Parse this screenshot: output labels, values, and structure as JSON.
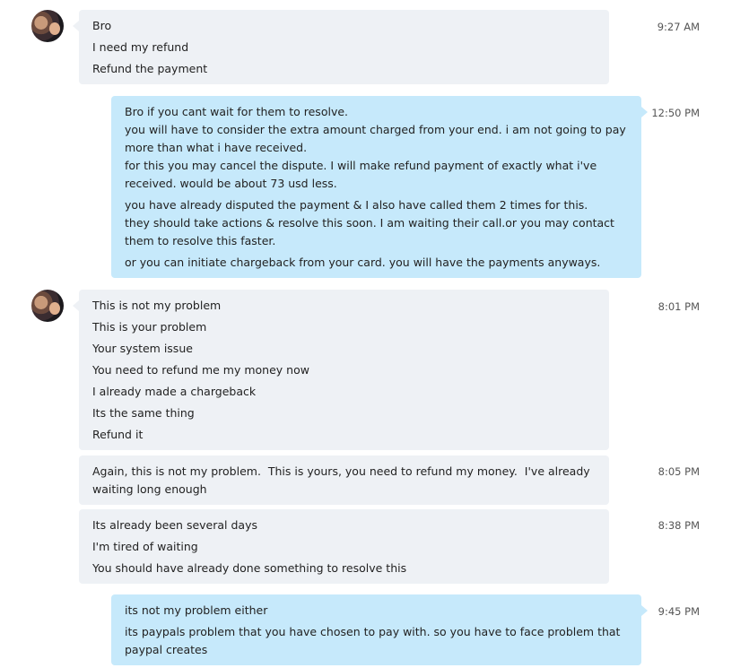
{
  "messages": [
    {
      "id": "m1",
      "time": "9:27 AM",
      "lines": [
        "Bro",
        "I need my refund",
        "Refund the payment"
      ]
    },
    {
      "id": "m2",
      "time": "12:50 PM",
      "lines": [
        "Bro if you cant wait for them to resolve.",
        "you will have to consider the extra amount charged from your end. i am not going to pay more than what i have received.",
        "for this you may cancel the dispute. I will make refund payment of exactly what i've received. would be about 73 usd less.",
        "you have already disputed the payment & I also have called them 2 times for this.",
        "they should take actions & resolve this soon. I am waiting their call.or you may contact them to resolve this faster.",
        "or you can initiate chargeback from your card. you will have the payments anyways."
      ]
    },
    {
      "id": "m3",
      "time": "8:01 PM",
      "lines": [
        "This is not my problem",
        "This is your problem",
        "Your system issue",
        "You need to refund me my money now",
        "I already made a chargeback",
        "Its the same thing",
        "Refund it"
      ]
    },
    {
      "id": "m4",
      "time": "8:05 PM",
      "lines": [
        "Again, this is not my problem.  This is yours, you need to refund my money.  I've already waiting long enough"
      ]
    },
    {
      "id": "m5",
      "time": "8:38 PM",
      "lines": [
        "Its already been several days",
        "I'm tired of waiting",
        "You should have already done something to resolve this"
      ]
    },
    {
      "id": "m6",
      "time": "9:45 PM",
      "lines": [
        "its not my problem either",
        "its paypals problem that you have chosen to pay with. so you have to face problem that paypal creates"
      ]
    }
  ]
}
